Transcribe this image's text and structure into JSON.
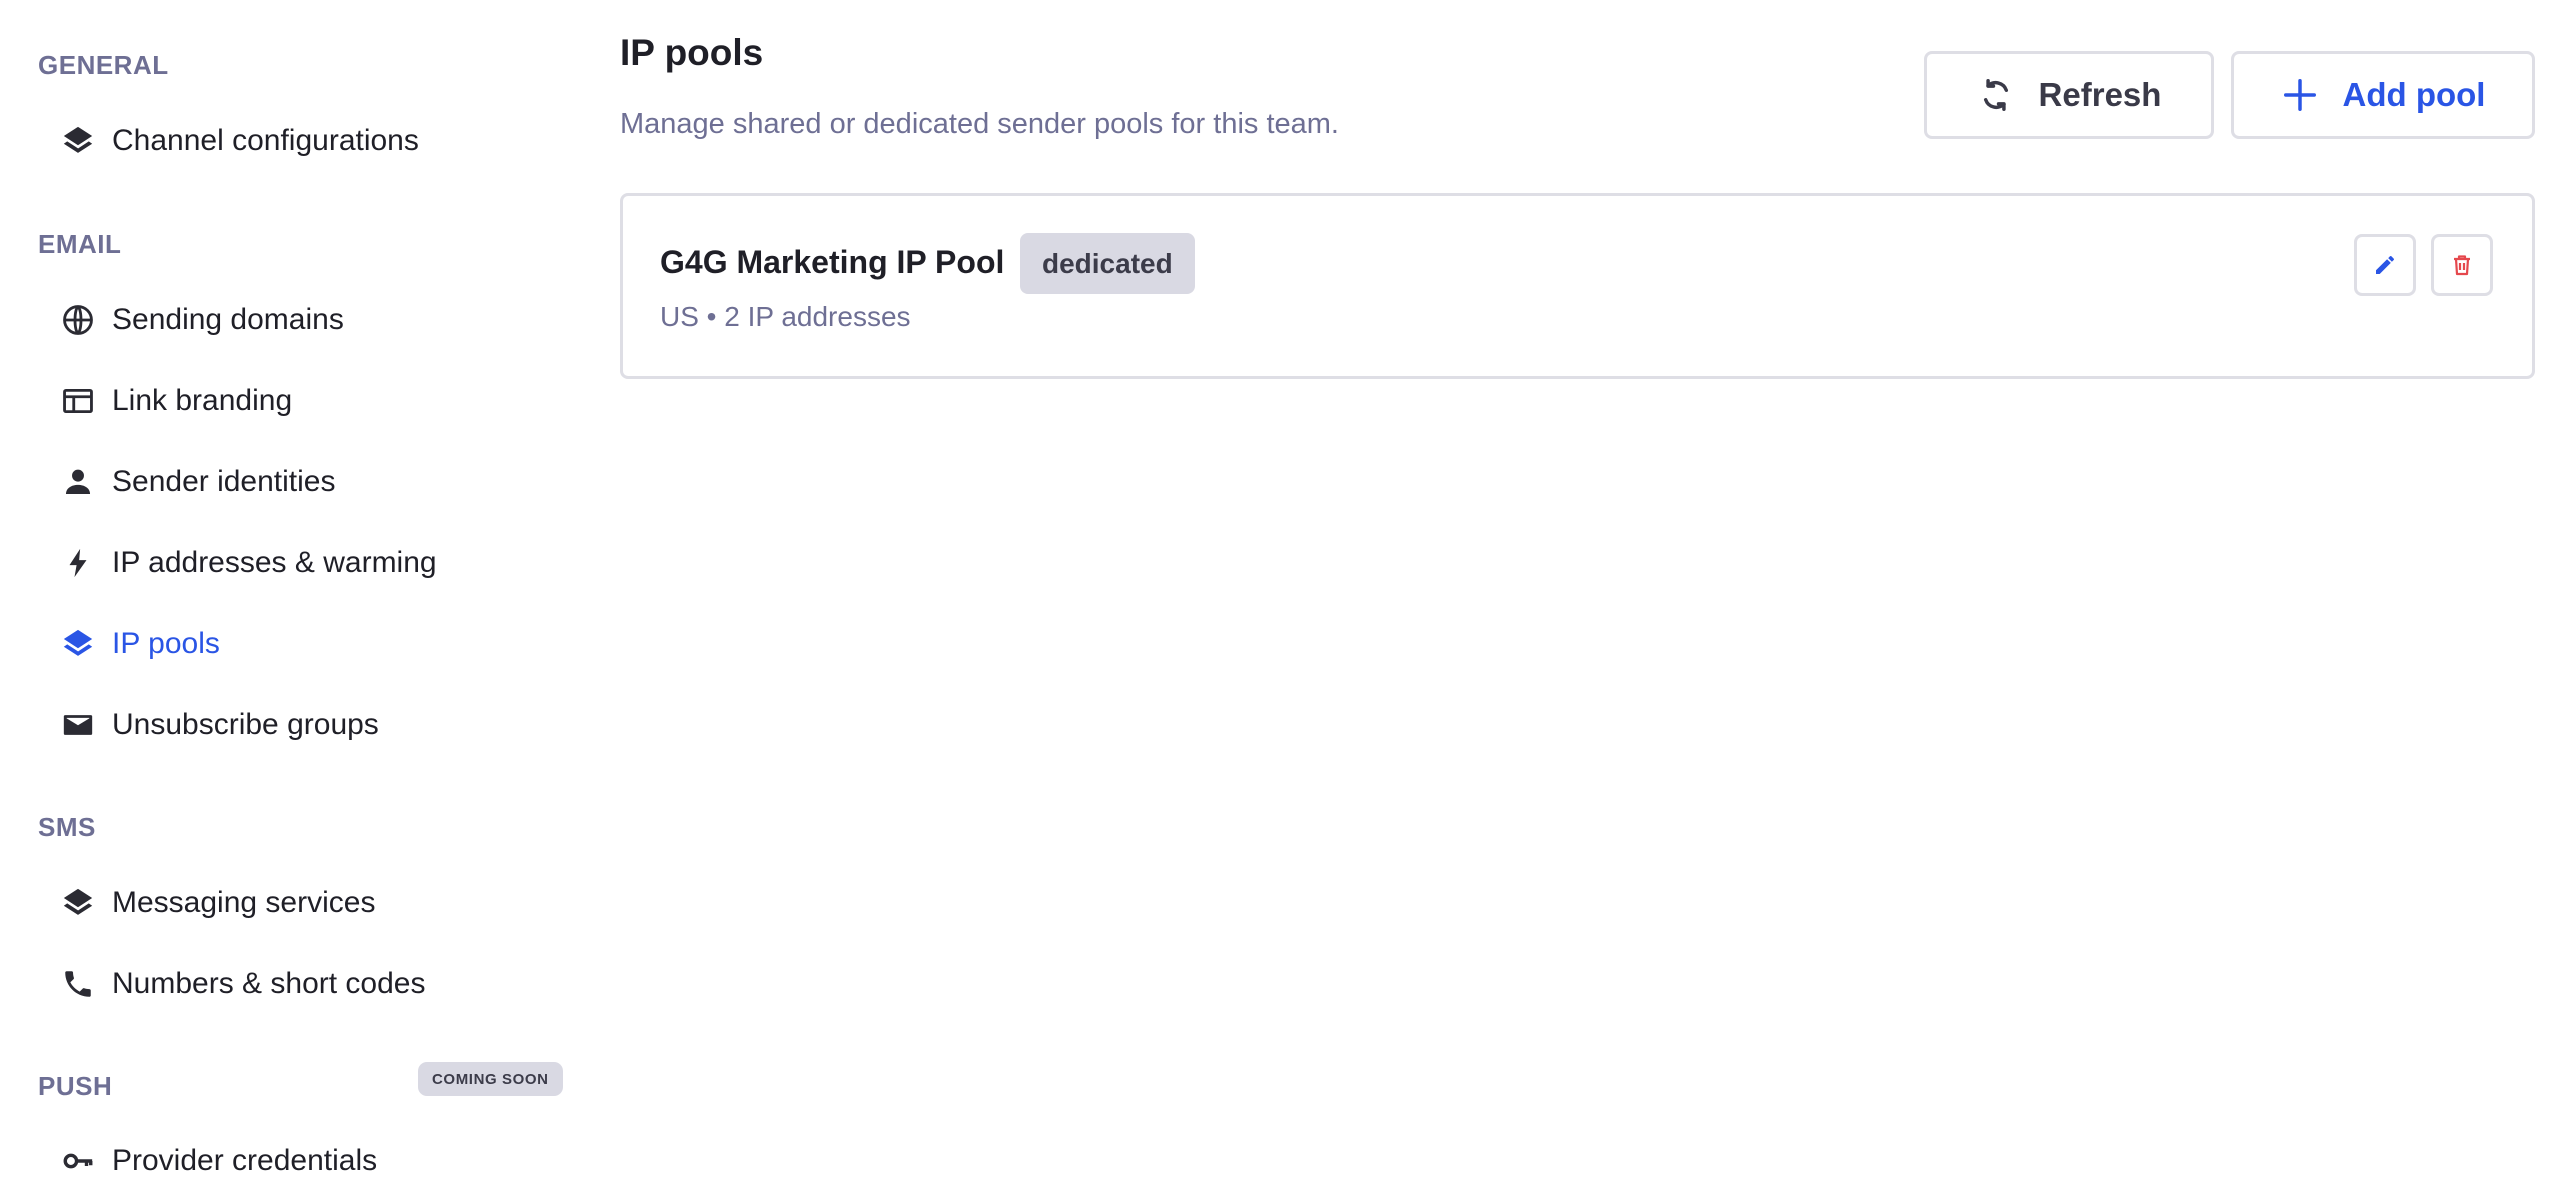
{
  "sidebar": {
    "sections": {
      "general": "GENERAL",
      "email": "EMAIL",
      "sms": "SMS",
      "push": "PUSH"
    },
    "push_badge": "COMING SOON",
    "items": {
      "channel_configurations": {
        "label": "Channel configurations",
        "icon": "layers-icon"
      },
      "sending_domains": {
        "label": "Sending domains",
        "icon": "globe-icon"
      },
      "link_branding": {
        "label": "Link branding",
        "icon": "browser-window-icon"
      },
      "sender_identities": {
        "label": "Sender identities",
        "icon": "person-icon"
      },
      "ip_addresses_warming": {
        "label": "IP addresses & warming",
        "icon": "bolt-icon"
      },
      "ip_pools": {
        "label": "IP pools",
        "icon": "layers-icon",
        "active": true
      },
      "unsubscribe_groups": {
        "label": "Unsubscribe groups",
        "icon": "envelope-icon"
      },
      "messaging_services": {
        "label": "Messaging services",
        "icon": "layers-icon"
      },
      "numbers_short_codes": {
        "label": "Numbers & short codes",
        "icon": "phone-icon"
      },
      "provider_credentials": {
        "label": "Provider credentials",
        "icon": "key-icon"
      }
    }
  },
  "main": {
    "title": "IP pools",
    "subtitle": "Manage shared or dedicated sender pools for this team.",
    "actions": {
      "refresh_label": "Refresh",
      "add_label": "Add pool"
    },
    "pools": [
      {
        "name": "G4G Marketing IP Pool",
        "type": "dedicated",
        "meta": "US • 2 IP addresses"
      }
    ]
  },
  "colors": {
    "accent": "#2a55e5",
    "muted_text": "#6e6f94",
    "badge_bg": "#d9d9e3",
    "border": "#dedee5",
    "danger": "#e5484d"
  }
}
